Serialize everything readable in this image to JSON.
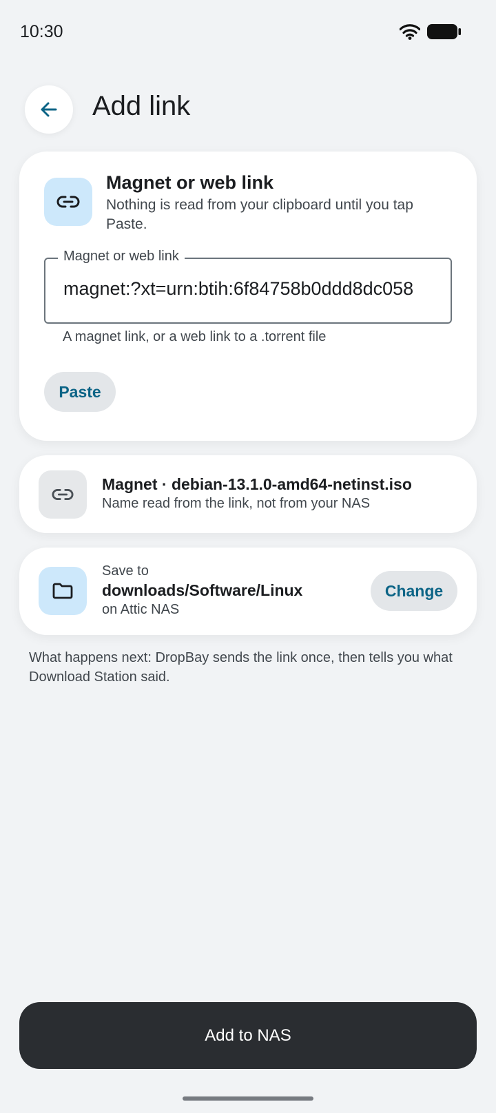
{
  "status_bar": {
    "time": "10:30",
    "icons": [
      "wifi-icon",
      "battery-icon"
    ]
  },
  "header": {
    "back_icon": "arrow-left-icon",
    "title": "Add link"
  },
  "link_card": {
    "icon": "link-icon",
    "title": "Magnet or web link",
    "subtitle": "Nothing is read from your clipboard until you tap Paste.",
    "field": {
      "label": "Magnet or web link",
      "value": "magnet:?xt=urn:btih:6f84758b0ddd8dc058",
      "helper": "A magnet link, or a web link to a .torrent file"
    },
    "paste_label": "Paste"
  },
  "magnet_card": {
    "icon": "link-icon",
    "title": "Magnet · debian-13.1.0-amd64-netinst.iso",
    "subtitle": "Name read from the link, not from your NAS"
  },
  "save_card": {
    "icon": "folder-icon",
    "label": "Save to",
    "path": "downloads/Software/Linux",
    "device": "on Attic NAS",
    "change_label": "Change"
  },
  "info_text": "What happens next: DropBay sends the link once, then tells you what Download Station said.",
  "primary_action": "Add to NAS",
  "colors": {
    "background": "#f1f3f5",
    "card": "#ffffff",
    "accent": "#0c6486",
    "icon_tile_blue": "#cde8fb",
    "icon_tile_gray": "#e6e8ea",
    "primary_button": "#2a2d31"
  }
}
